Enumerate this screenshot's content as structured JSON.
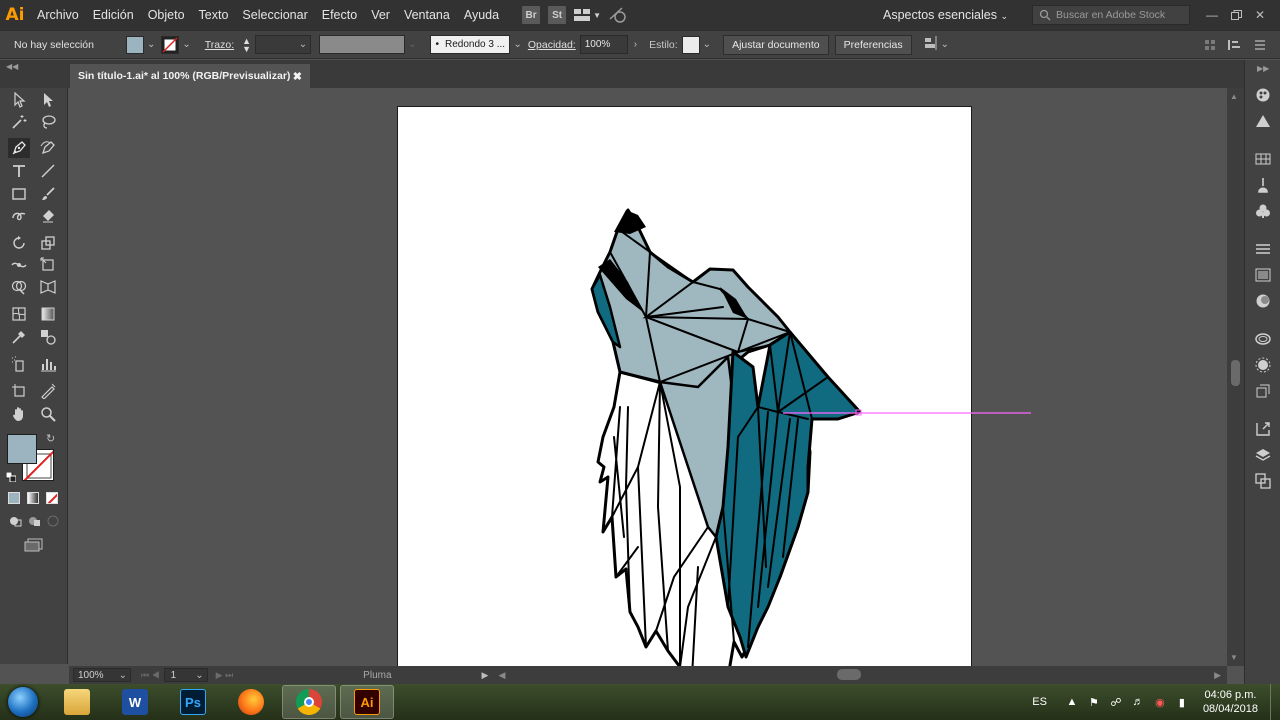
{
  "app": {
    "logo": "Ai",
    "menu": [
      "Archivo",
      "Edición",
      "Objeto",
      "Texto",
      "Seleccionar",
      "Efecto",
      "Ver",
      "Ventana",
      "Ayuda"
    ],
    "bridge_icon": "Br",
    "stock_icon": "St",
    "workspace": "Aspectos esenciales",
    "search_placeholder": "Buscar en Adobe Stock"
  },
  "control_bar": {
    "selection": "No hay selección",
    "fill_color": "#9bb4bf",
    "stroke_label": "Trazo:",
    "brush": "Redondo 3 ...",
    "opacity_label": "Opacidad:",
    "opacity_value": "100%",
    "style_label": "Estilo:",
    "fit_button": "Ajustar documento",
    "prefs_button": "Preferencias"
  },
  "document": {
    "tab_title": "Sin título-1.ai* al 100% (RGB/Previsualizar)"
  },
  "status": {
    "zoom": "100%",
    "page": "1",
    "tool": "Pluma"
  },
  "artwork": {
    "colors": {
      "teal": "#106a80",
      "gray_blue": "#9fb7bf",
      "black": "#000000",
      "white": "#ffffff",
      "guide": "#ff66ff"
    }
  },
  "taskbar": {
    "apps": [
      {
        "name": "explorer",
        "label": ""
      },
      {
        "name": "word",
        "label": "W"
      },
      {
        "name": "photoshop",
        "label": "Ps"
      },
      {
        "name": "firefox",
        "label": ""
      },
      {
        "name": "chrome",
        "label": ""
      },
      {
        "name": "illustrator",
        "label": "Ai"
      }
    ],
    "language": "ES",
    "time": "04:06 p.m.",
    "date": "08/04/2018"
  }
}
